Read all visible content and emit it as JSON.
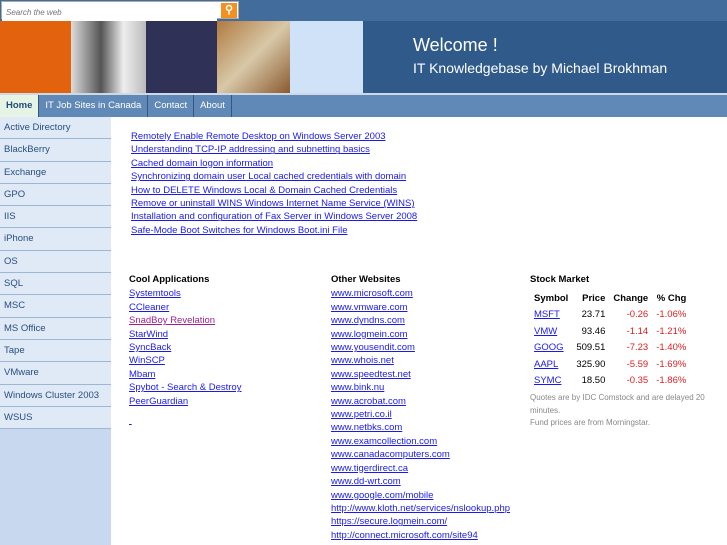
{
  "search": {
    "placeholder": "Search the web"
  },
  "header": {
    "welcome": "Welcome !",
    "subtitle": "IT Knowledgebase by Michael Brokhman"
  },
  "nav": [
    "Home",
    "IT Job Sites in Canada",
    "Contact",
    "About"
  ],
  "sidebar": [
    "Active Directory",
    "BlackBerry",
    "Exchange",
    "GPO",
    "IIS",
    "iPhone",
    "OS",
    "SQL",
    "MSC",
    "MS Office",
    "Tape",
    "VMware",
    "Windows Cluster 2003",
    "WSUS"
  ],
  "articles": [
    "Remotely Enable Remote Desktop on Windows Server 2003",
    "Understanding TCP-IP addressing and subnetting basics",
    "Cached domain logon information",
    "Synchronizing domain user Local cached credentials with domain",
    "How to DELETE Windows Local & Domain Cached Credentials",
    "Remove or uninstall WINS Windows Internet Name Service (WINS)",
    "Installation and configuration of Fax Server in Windows Server 2008",
    "Safe-Mode Boot Switches for Windows Boot.ini File"
  ],
  "cool": {
    "title": "Cool Applications",
    "items": [
      "Systemtools",
      "CCleaner",
      "SnadBoy  Revelation",
      "StarWind",
      "SyncBack",
      "WinSCP",
      "Mbam",
      "Spybot - Search & Destroy",
      "PeerGuardian"
    ]
  },
  "other": {
    "title": "Other Websites",
    "items": [
      "www.microsoft.com",
      "www.vmware.com",
      "www.dyndns.com",
      "www.logmein.com",
      "www.yousendit.com",
      "www.whois.net",
      "www.speedtest.net",
      "www.bink.nu",
      "www.acrobat.com",
      "www.petri.co.il",
      "www.netbks.com",
      "www.examcollection.com",
      "www.canadacomputers.com",
      "www.tigerdirect.ca",
      "www.dd-wrt.com",
      "www.google.com/mobile",
      "http://www.kloth.net/services/nslookup.php",
      "https://secure.logmein.com/",
      "http://connect.microsoft.com/site94"
    ]
  },
  "stock": {
    "title": "Stock Market",
    "headers": [
      "Symbol",
      "Price",
      "Change",
      "% Chg"
    ],
    "rows": [
      [
        "MSFT",
        "23.71",
        "-0.26",
        "-1.06%"
      ],
      [
        "VMW",
        "93.46",
        "-1.14",
        "-1.21%"
      ],
      [
        "GOOG",
        "509.51",
        "-7.23",
        "-1.40%"
      ],
      [
        "AAPL",
        "325.90",
        "-5.59",
        "-1.69%"
      ],
      [
        "SYMC",
        "18.50",
        "-0.35",
        "-1.86%"
      ]
    ],
    "note1": "Quotes are by IDC Comstock and are delayed 20 minutes.",
    "note2": "Fund prices are from Morningstar."
  }
}
